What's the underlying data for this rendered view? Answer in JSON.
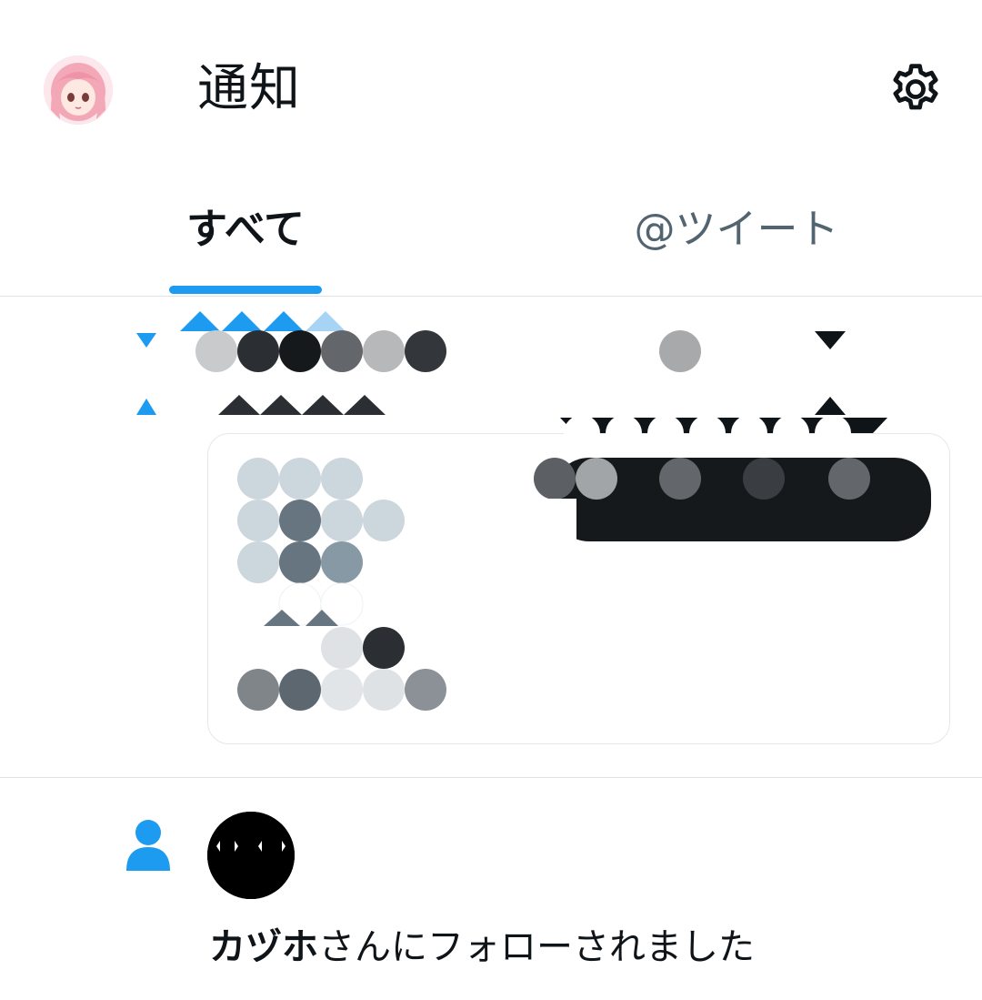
{
  "header": {
    "title": "通知",
    "avatar_icon": "user-avatar-icon",
    "settings_icon": "gear-icon"
  },
  "tabs": [
    {
      "label": "すべて",
      "selected": true
    },
    {
      "label": "@ツイート",
      "selected": false
    }
  ],
  "colors": {
    "accent": "#1d9bf0",
    "text_primary": "#0f1419",
    "text_secondary": "#536471",
    "divider": "#dfe3e6"
  },
  "notifications": [
    {
      "type": "censored",
      "icon": "mosaic-censored-content"
    },
    {
      "type": "follow",
      "icon": "person-icon",
      "follower_name": "カヅホ",
      "message_suffix": "さんにフォローされました"
    }
  ]
}
